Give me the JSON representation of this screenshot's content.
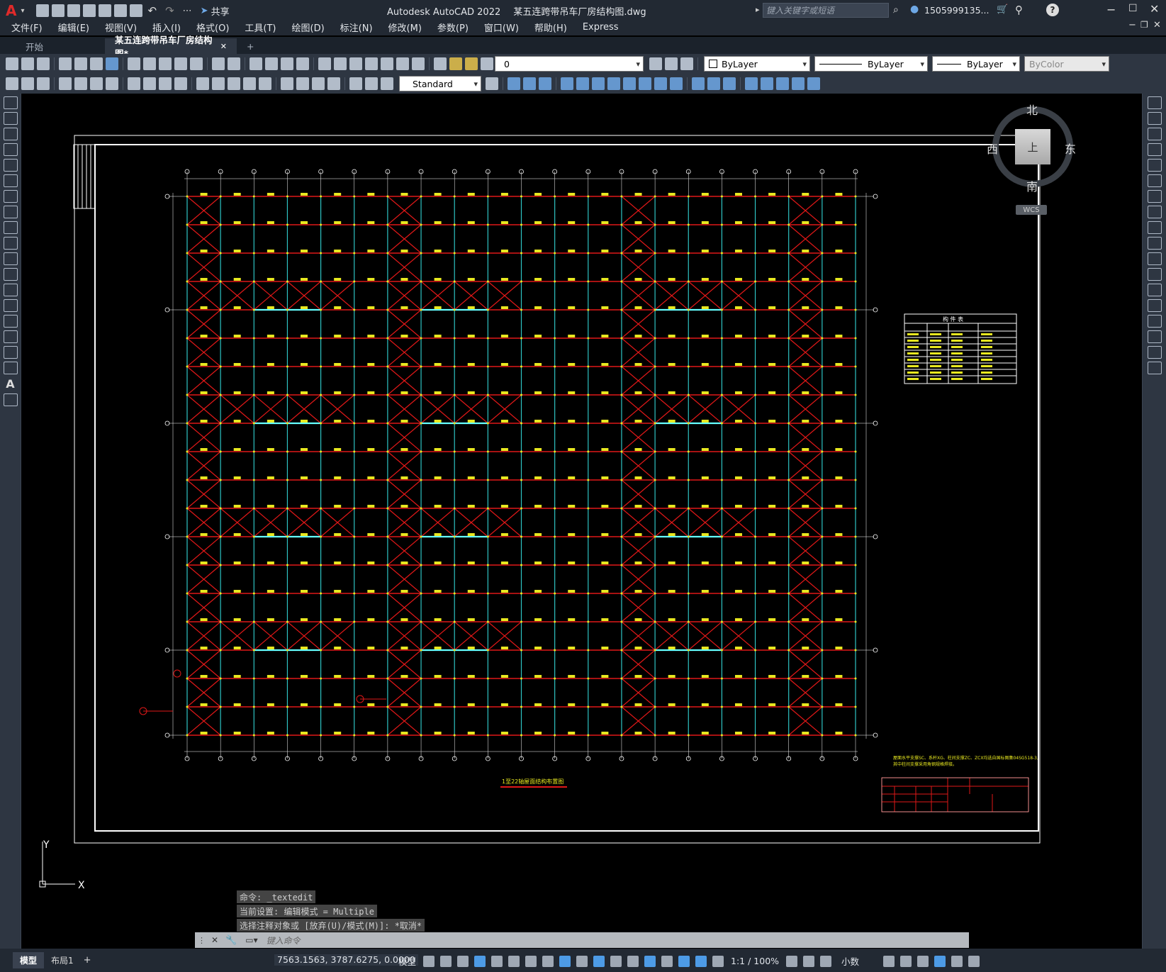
{
  "window": {
    "app_name": "Autodesk AutoCAD 2022",
    "file_name": "某五连跨带吊车厂房结构图.dwg",
    "share_label": "共享",
    "search_placeholder": "键入关键字或短语",
    "user_name": "1505999135...",
    "logo": "A"
  },
  "menu": [
    "文件(F)",
    "编辑(E)",
    "视图(V)",
    "插入(I)",
    "格式(O)",
    "工具(T)",
    "绘图(D)",
    "标注(N)",
    "修改(M)",
    "参数(P)",
    "窗口(W)",
    "帮助(H)",
    "Express"
  ],
  "tabs": {
    "start_label": "开始",
    "doc_label": "某五连跨带吊车厂房结构图*",
    "close_glyph": "✕",
    "add_glyph": "+"
  },
  "properties": {
    "layer": "0",
    "color": "ByLayer",
    "linetype": "ByLayer",
    "lineweight": "ByLayer",
    "plotstyle": "ByColor",
    "text_style": "Standard"
  },
  "viewcube": {
    "north": "北",
    "south": "南",
    "east": "东",
    "west": "西",
    "face": "上",
    "wcs": "WCS"
  },
  "drawing": {
    "title": "1至22轴屋面结构布置图",
    "note_line1": "屋面水平支撑SC、系杆XG、柱间支撑ZC、ZCX均选自国标图集04SG518-3,",
    "note_line2": "其中柱间支撑采用角钢规格焊接。",
    "table_title": "构 件 表",
    "colors": {
      "beam": "#e01818",
      "column": "#2ec4c4",
      "label": "#e8e820",
      "frame": "#ffffff"
    }
  },
  "commands": {
    "line1": "命令: _textedit",
    "line2": "当前设置: 编辑模式 = Multiple",
    "line3": "选择注释对象或 [放弃(U)/模式(M)]: *取消*",
    "input_placeholder": "键入命令"
  },
  "ucs": {
    "x": "X",
    "y": "Y"
  },
  "status": {
    "model_tab": "模型",
    "layout_tab": "布局1",
    "add_tab": "+",
    "coords": "7563.1563, 3787.6275, 0.0000",
    "space": "模型",
    "scale": "1:1 / 100%",
    "units": "小数"
  }
}
